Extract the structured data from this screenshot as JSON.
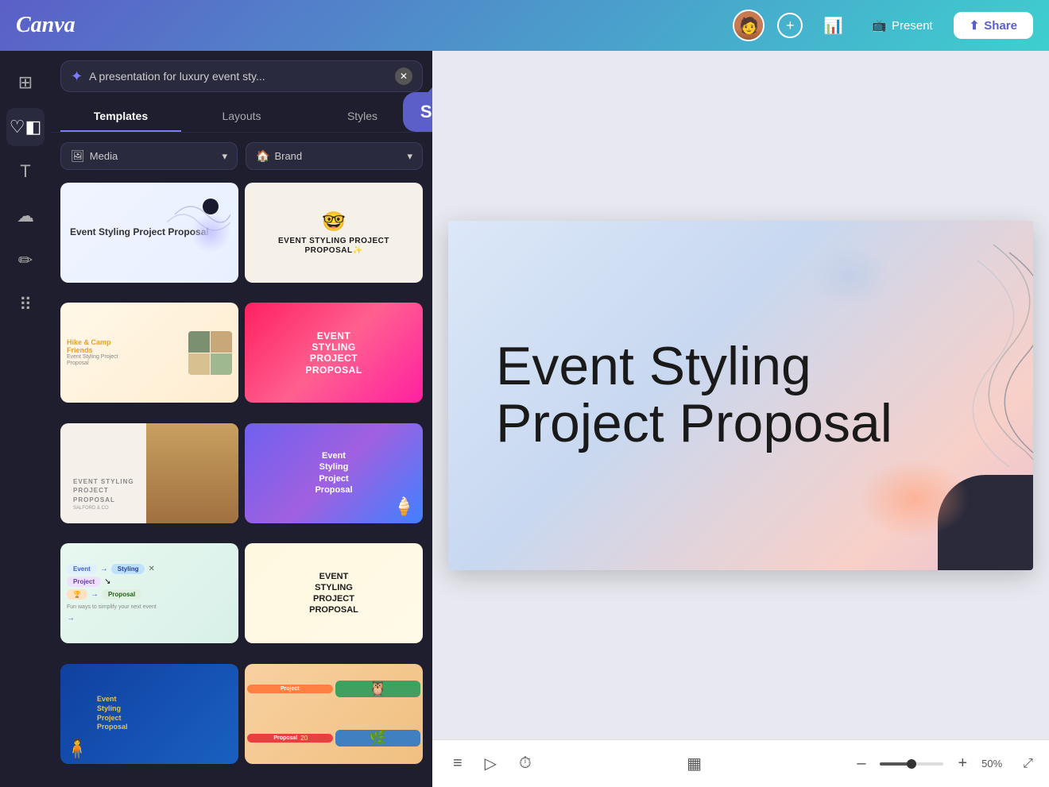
{
  "topbar": {
    "logo": "Canva",
    "plus_label": "+",
    "present_label": "Present",
    "share_label": "Share"
  },
  "search": {
    "placeholder": "A presentation for luxury event sty...",
    "value": "A presentation for luxury event sty...",
    "tooltip_name": "Sarah"
  },
  "tabs": {
    "items": [
      {
        "label": "Templates",
        "active": true
      },
      {
        "label": "Layouts",
        "active": false
      },
      {
        "label": "Styles",
        "active": false
      }
    ]
  },
  "filters": {
    "media_label": "Media",
    "brand_label": "Brand"
  },
  "templates": [
    {
      "id": 1,
      "title": "Event Styling Project Proposal",
      "style": "minimal-blue"
    },
    {
      "id": 2,
      "title": "Event Styling Project Proposal",
      "style": "retro-cartoon"
    },
    {
      "id": 3,
      "title": "Event Styling Project Proposal",
      "style": "hike-camp"
    },
    {
      "id": 4,
      "title": "Event Styling Project Proposal",
      "style": "bold-pink"
    },
    {
      "id": 5,
      "title": "Event Styling Project Proposal",
      "style": "elegant-beige"
    },
    {
      "id": 6,
      "title": "Event Styling Project Proposal",
      "style": "purple-fun"
    },
    {
      "id": 7,
      "title": "Event Styling Project Proposal",
      "style": "tag-flow"
    },
    {
      "id": 8,
      "title": "Event Styling Project Proposal",
      "style": "bold-yellow"
    },
    {
      "id": 9,
      "title": "Event Styling Project Proposal",
      "style": "blue-person"
    },
    {
      "id": 10,
      "title": "Event Styling Project Proposal",
      "style": "colorful-tiles"
    }
  ],
  "slide": {
    "title": "Event Styling Project Proposal"
  },
  "toolbar": {
    "zoom_percent": "50%",
    "notes_icon": "📝",
    "play_icon": "▶",
    "timer_icon": "⏱",
    "grid_icon": "▦"
  }
}
